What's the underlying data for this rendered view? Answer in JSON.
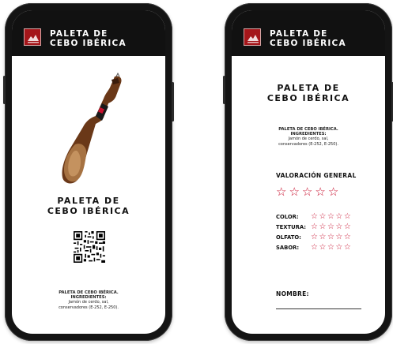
{
  "header": {
    "title": "PALETA DE\nCEBO IBÉRICA"
  },
  "left_screen": {
    "product_title": "PALETA DE\nCEBO IBÉRICA",
    "ingredients": {
      "title": "PALETA DE CEBO IBÉRICA.",
      "subtitle": "INGREDIENTES:",
      "line1": "Jamón de cerdo, sal,",
      "line2": "conservadores (E-252, E-250)."
    }
  },
  "right_screen": {
    "product_title": "PALETA DE\nCEBO IBÉRICA",
    "ingredients": {
      "title": "PALETA DE CEBO IBÉRICA.",
      "subtitle": "INGREDIENTES:",
      "line1": "Jamón de cerdo, sal,",
      "line2": "conservadores (E-252, E-250)."
    },
    "general_rating_label": "VALORACIÓN GENERAL",
    "ratings": [
      {
        "label": "COLOR:"
      },
      {
        "label": "TEXTURA:"
      },
      {
        "label": "OLFATO:"
      },
      {
        "label": "SABOR:"
      }
    ],
    "name_label": "NOMBRE:"
  },
  "colors": {
    "accent_red": "#c8102e",
    "header_black": "#111111"
  },
  "icons": {
    "star": "☆",
    "logo": "brand-logo-icon"
  }
}
